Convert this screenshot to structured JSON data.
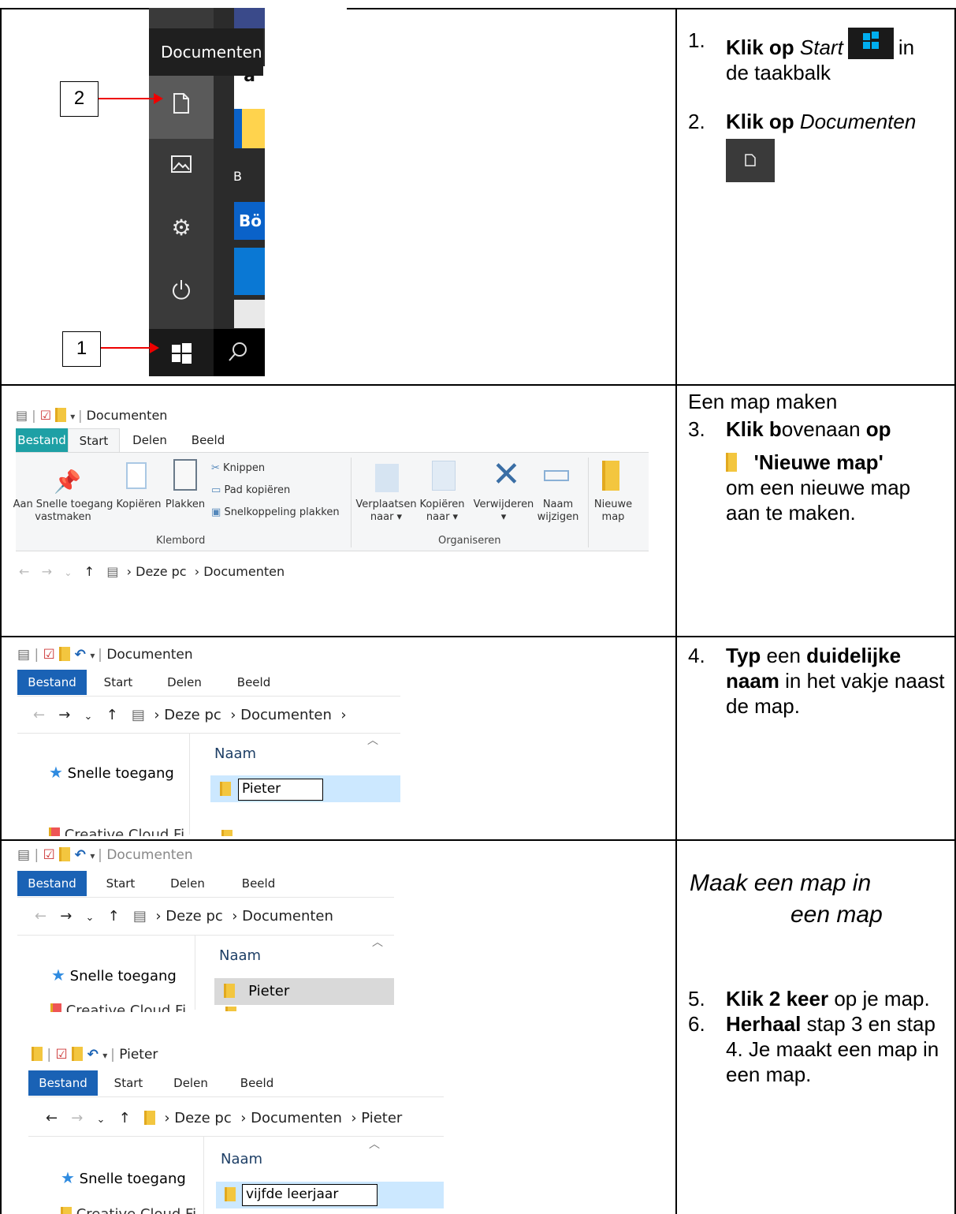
{
  "row1": {
    "startmenu": {
      "tooltip": "Documenten",
      "tile_letter_a": "a",
      "tile_letter_b": "B",
      "tile_bo": "Bö",
      "callout_1": "1",
      "callout_2": "2",
      "icons": [
        "document-icon",
        "pictures-icon",
        "settings-icon",
        "power-icon",
        "windows-start-icon",
        "search-icon"
      ]
    },
    "steps": [
      {
        "num": "1.",
        "b1": "Klik op",
        "i1": "Start",
        "after_icon": "in",
        "line2": "de taakbalk"
      },
      {
        "num": "2.",
        "b1": "Klik op",
        "i1": "Documenten"
      }
    ]
  },
  "row2": {
    "qat_title": "Documenten",
    "tabs": [
      "Bestand",
      "Start",
      "Delen",
      "Beeld"
    ],
    "ribbon": {
      "pin": [
        "Aan Snelle toegang",
        "vastmaken"
      ],
      "copy": "Kopiëren",
      "paste": "Plakken",
      "cut": "Knippen",
      "copy_path": "Pad kopiëren",
      "paste_shortcut": "Snelkoppeling plakken",
      "group_clipboard": "Klembord",
      "move_to": [
        "Verplaatsen",
        "naar"
      ],
      "copy_to": [
        "Kopiëren",
        "naar"
      ],
      "delete": "Verwijderen",
      "rename": [
        "Naam",
        "wijzigen"
      ],
      "new_folder": [
        "Nieuwe",
        "map"
      ],
      "group_organize": "Organiseren"
    },
    "address": [
      "Deze pc",
      "Documenten"
    ],
    "heading": "Een map maken",
    "step": {
      "num": "3.",
      "b1": "Klik b",
      "t1": "ovenaan ",
      "b2": "op",
      "b3": "'Nieuwe map'",
      "t2": "om een nieuwe map",
      "t3": "aan te maken."
    }
  },
  "row3": {
    "qat_title": "Documenten",
    "tabs": [
      "Bestand",
      "Start",
      "Delen",
      "Beeld"
    ],
    "address": [
      "Deze pc",
      "Documenten"
    ],
    "col_name": "Naam",
    "quick_access": "Snelle toegang",
    "creative_cloud": "Creative Cloud Fi",
    "rename_value": "Pieter",
    "step": {
      "num": "4.",
      "b1": "Typ",
      "t1": " een ",
      "b2": "duidelijke naam",
      "t2": " in het vakje naast de map."
    }
  },
  "row4": {
    "a": {
      "qat_title": "Documenten",
      "tabs": [
        "Bestand",
        "Start",
        "Delen",
        "Beeld"
      ],
      "address": [
        "Deze pc",
        "Documenten"
      ],
      "col_name": "Naam",
      "quick_access": "Snelle toegang",
      "creative_cloud": "Creative Cloud Fi",
      "folder_name": "Pieter"
    },
    "b": {
      "qat_title": "Pieter",
      "tabs": [
        "Bestand",
        "Start",
        "Delen",
        "Beeld"
      ],
      "address": [
        "Deze pc",
        "Documenten",
        "Pieter"
      ],
      "col_name": "Naam",
      "quick_access": "Snelle toegang",
      "creative_cloud": "Creative Cloud Fi",
      "rename_value": "vijfde leerjaar"
    },
    "heading_line1": "Maak een map in",
    "heading_line2": "een map",
    "steps": [
      {
        "num": "5.",
        "b1": "Klik 2 keer",
        "t1": " op je map."
      },
      {
        "num": "6.",
        "b1": "Herhaal",
        "t1": " stap 3 en stap 4. Je maakt een map in een map."
      }
    ]
  }
}
